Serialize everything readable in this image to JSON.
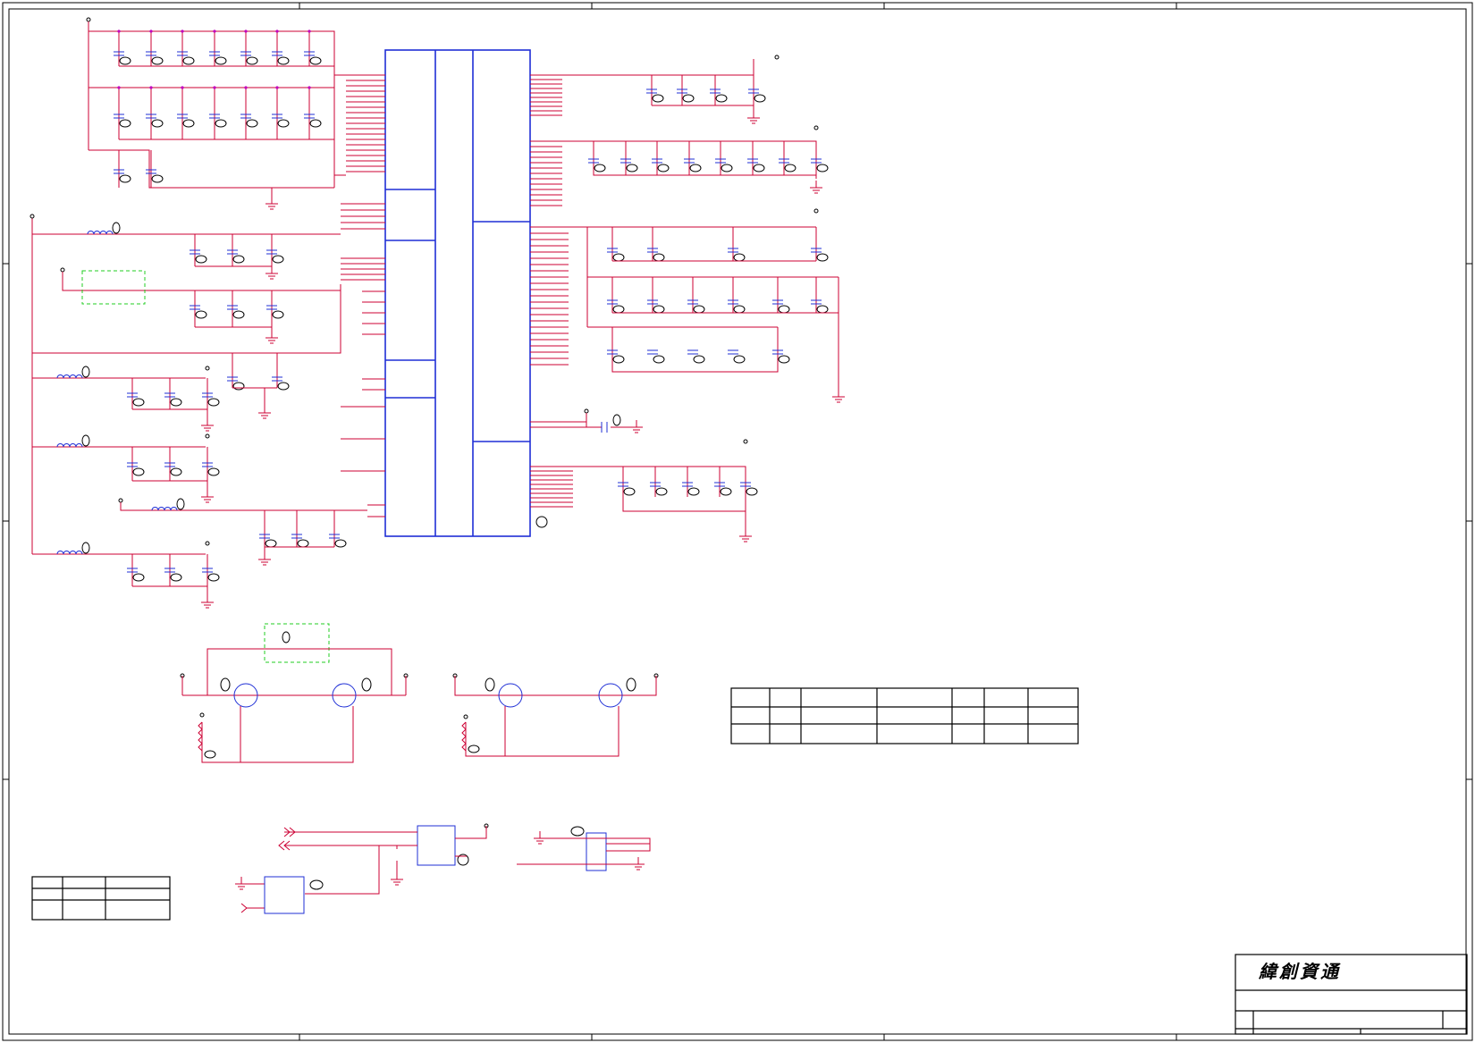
{
  "title_block": {
    "company": "緯創資通"
  }
}
